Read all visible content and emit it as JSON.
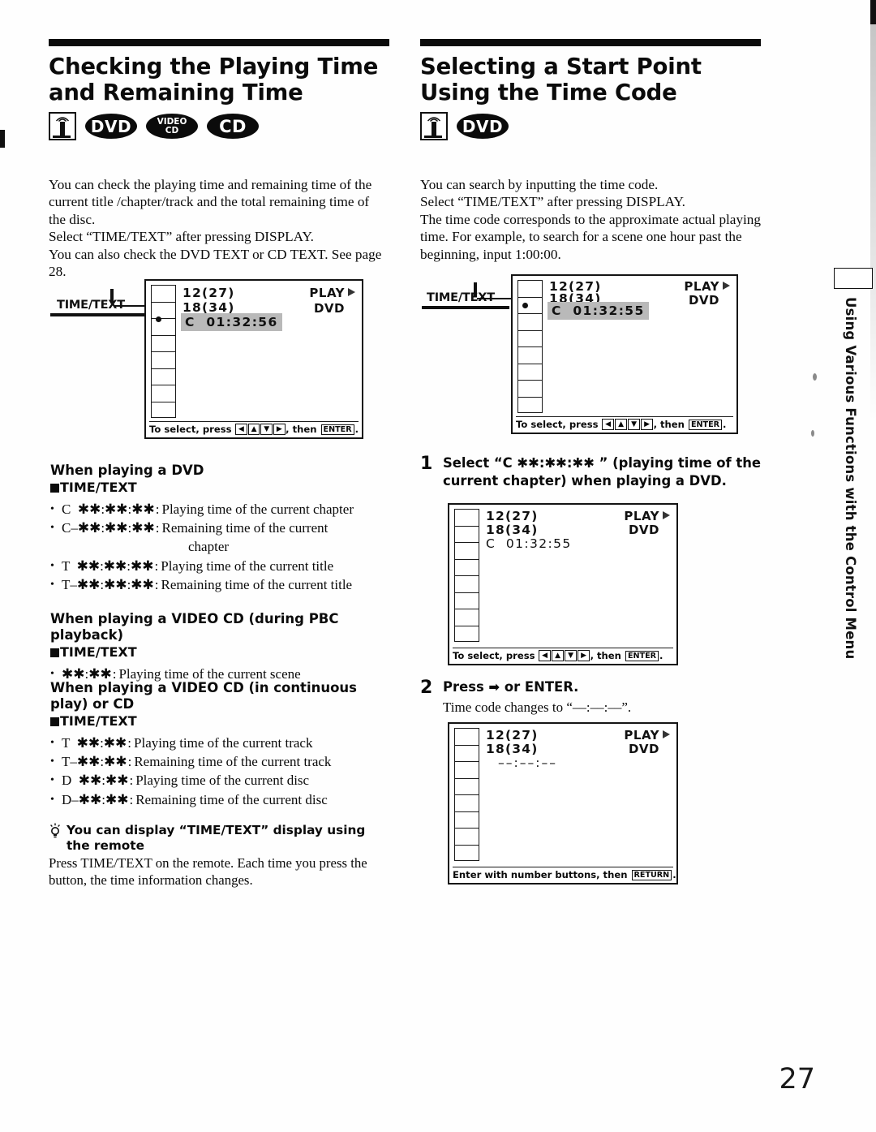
{
  "page": {
    "number": "27",
    "side_tab": "Using Various Functions with the Control Menu"
  },
  "left_column": {
    "title": "Checking the Playing Time and Remaining Time",
    "badges": [
      {
        "name": "remote-icon",
        "label": ""
      },
      {
        "name": "dvd-badge",
        "label": "DVD"
      },
      {
        "name": "video-cd-badge",
        "label": "VIDEO\nCD"
      },
      {
        "name": "cd-badge",
        "label": "CD"
      }
    ],
    "intro": "You can check the playing time and remaining time of the current title /chapter/track and the total remaining time of the disc.\nSelect “TIME/TEXT” after pressing DISPLAY.\nYou can also check the DVD TEXT or CD TEXT.  See page 28.",
    "callout_label": "TIME/TEXT",
    "screen": {
      "line1": "12(27)",
      "line2": "18(34)",
      "line3": "C  01:32:56",
      "line3_highlighted": true,
      "status": "PLAY",
      "disc_type": "DVD",
      "footer_pre": "To select, press",
      "footer_keys": [
        "◄",
        "▲",
        "▼",
        "►"
      ],
      "footer_mid": ", then",
      "footer_key_enter": "ENTER",
      "footer_post": "."
    },
    "section_dvd": {
      "heading": "When playing a DVD",
      "mode": "TIME/TEXT",
      "items": [
        {
          "code": "C  ✱✱:✱✱:✱✱",
          "desc": "Playing time of the current chapter",
          "cont": ""
        },
        {
          "code": "C–✱✱:✱✱:✱✱",
          "desc": "Remaining time of the current",
          "cont": "chapter"
        },
        {
          "code": "T  ✱✱:✱✱:✱✱",
          "desc": "Playing time of the current title",
          "cont": ""
        },
        {
          "code": "T–✱✱:✱✱:✱✱",
          "desc": "Remaining time of the current title",
          "cont": ""
        }
      ]
    },
    "section_vcd_pbc": {
      "heading": "When playing a VIDEO CD (during PBC playback)",
      "mode": "TIME/TEXT",
      "items": [
        {
          "code": "✱✱:✱✱",
          "desc": "Playing time of the current scene",
          "cont": ""
        }
      ]
    },
    "section_vcd_cd": {
      "heading": "When playing a VIDEO CD (in continuous play) or CD",
      "mode": "TIME/TEXT",
      "items": [
        {
          "code": "T  ✱✱:✱✱",
          "desc": "Playing time of the current track",
          "cont": ""
        },
        {
          "code": "T–✱✱:✱✱",
          "desc": "Remaining time of the current track",
          "cont": ""
        },
        {
          "code": "D  ✱✱:✱✱",
          "desc": "Playing time of the current disc",
          "cont": ""
        },
        {
          "code": "D–✱✱:✱✱",
          "desc": "Remaining time of the current disc",
          "cont": ""
        }
      ]
    },
    "tip": {
      "heading": "You can display “TIME/TEXT” display using the remote",
      "body": "Press TIME/TEXT on the remote.  Each time you press the button, the time information changes."
    }
  },
  "right_column": {
    "title": "Selecting a Start Point Using the Time Code",
    "badges": [
      {
        "name": "remote-icon",
        "label": ""
      },
      {
        "name": "dvd-badge",
        "label": "DVD"
      }
    ],
    "intro": "You can search by inputting the time code.\nSelect “TIME/TEXT” after pressing DISPLAY.\nThe time code corresponds to the approximate actual playing time. For example, to search for a scene one hour past the beginning, input 1:00:00.",
    "callout_label": "TIME/TEXT",
    "screen_top": {
      "line1": "12(27)",
      "line2": "18(34)",
      "line3": "C  01:32:55",
      "line3_highlighted": true,
      "status": "PLAY",
      "disc_type": "DVD",
      "footer_pre": "To select, press",
      "footer_keys": [
        "◄",
        "▲",
        "▼",
        "►"
      ],
      "footer_mid": ", then",
      "footer_key_enter": "ENTER",
      "footer_post": "."
    },
    "step1": {
      "number": "1",
      "text": "Select “C ✱✱:✱✱:✱✱ ” (playing time of the current chapter) when playing a DVD.",
      "screen": {
        "line1": "12(27)",
        "line2": "18(34)",
        "line3": "C  01:32:55",
        "line3_highlighted": false,
        "status": "PLAY",
        "disc_type": "DVD",
        "footer_pre": "To select, press",
        "footer_keys": [
          "◄",
          "▲",
          "▼",
          "►"
        ],
        "footer_mid": ", then",
        "footer_key_enter": "ENTER",
        "footer_post": "."
      }
    },
    "step2": {
      "number": "2",
      "text": "Press ➡ or ENTER.",
      "subtext": "Time code changes to “––:––:––”.",
      "screen": {
        "line1": "12(27)",
        "line2": "18(34)",
        "line3": "––:––:––",
        "line3_highlighted": false,
        "status": "PLAY",
        "disc_type": "DVD",
        "footer_pre": "Enter with number buttons, then",
        "footer_keys": [],
        "footer_mid": "",
        "footer_key_enter": "RETURN",
        "footer_post": "."
      }
    }
  }
}
